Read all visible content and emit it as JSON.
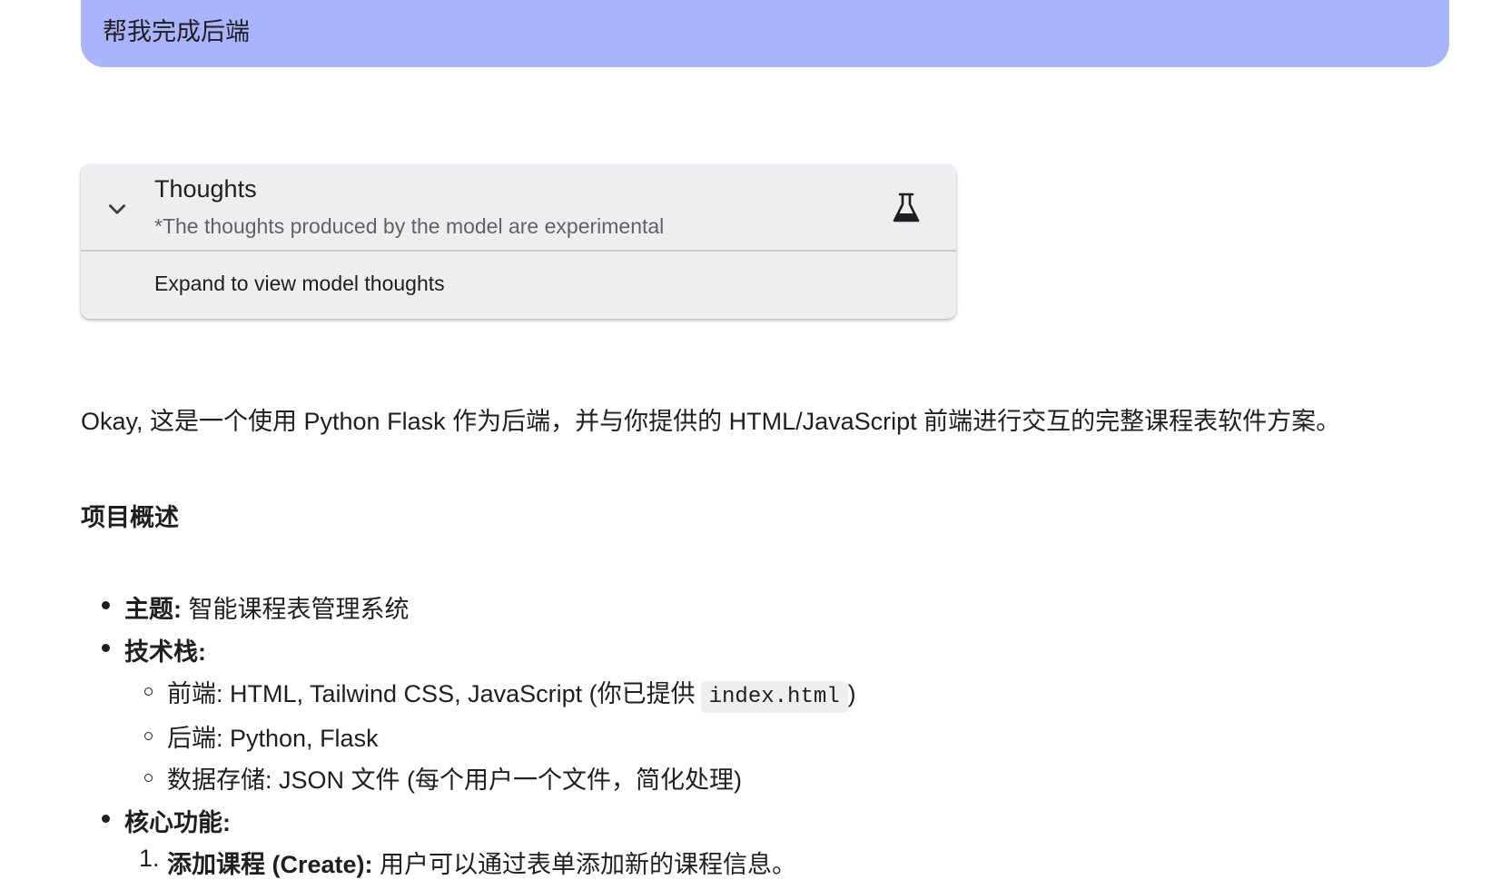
{
  "user_message": {
    "text": "帮我完成后端",
    "color": "#a8b4fb"
  },
  "thoughts": {
    "title": "Thoughts",
    "subtitle": "*The thoughts produced by the model are experimental",
    "expand_label": "Expand to view model thoughts",
    "toggle_icon": "chevron-down-icon",
    "badge_icon": "flask-icon"
  },
  "response": {
    "intro": "Okay, 这是一个使用 Python Flask 作为后端，并与你提供的 HTML/JavaScript 前端进行交互的完整课程表软件方案。",
    "heading": "项目概述",
    "items": {
      "theme": {
        "label": "主题:",
        "value": " 智能课程表管理系统"
      },
      "tech": {
        "label": "技术栈:",
        "sub": [
          {
            "text": "前端: HTML, Tailwind CSS, JavaScript (你已提供",
            "code": "index.html",
            "tail": ")"
          },
          {
            "text": "后端: Python, Flask"
          },
          {
            "text": "数据存储: JSON 文件 (每个用户一个文件，简化处理)"
          }
        ]
      },
      "features": {
        "label": "核心功能:",
        "list": [
          {
            "num": "1.",
            "label": "添加课程 (Create):",
            "value": " 用户可以通过表单添加新的课程信息。"
          }
        ]
      }
    }
  }
}
